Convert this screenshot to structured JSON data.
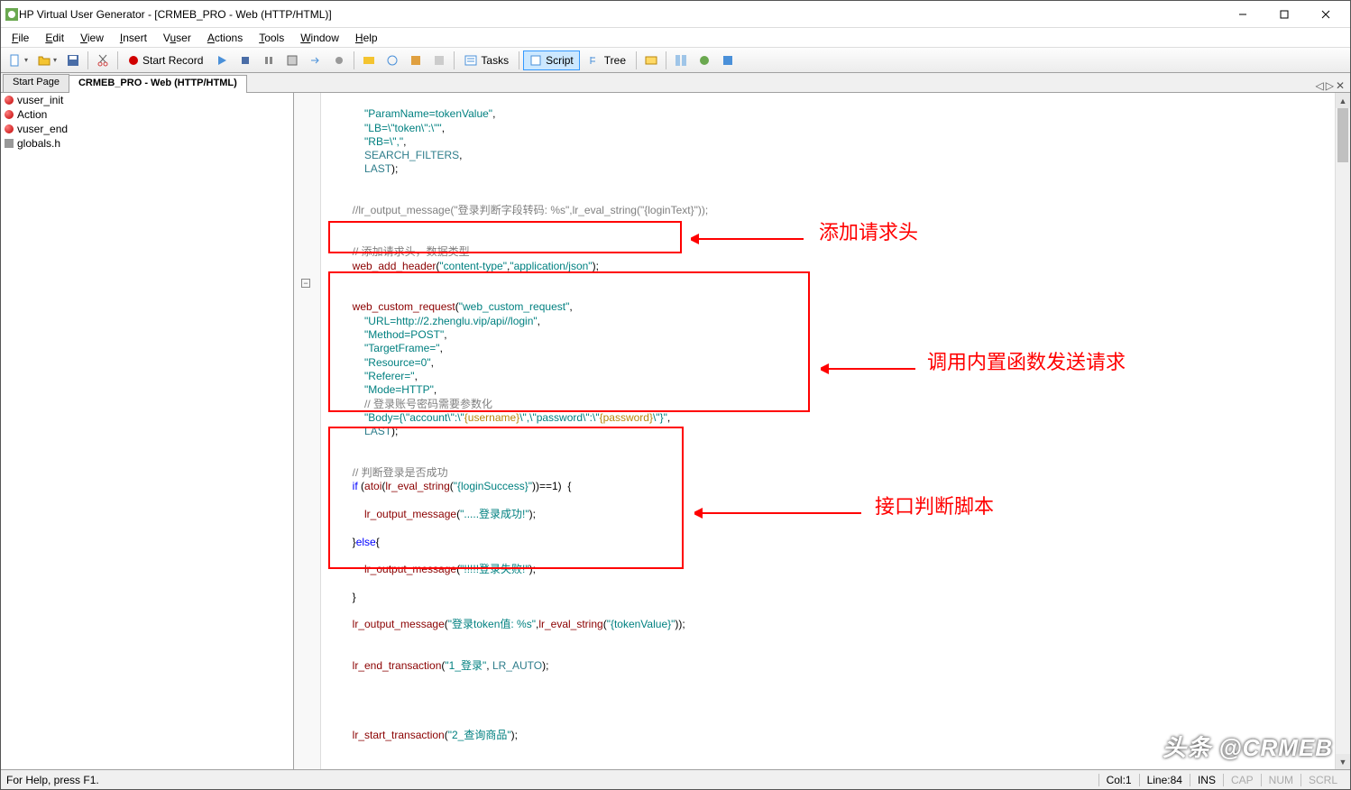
{
  "window": {
    "title": "HP Virtual User Generator - [CRMEB_PRO - Web (HTTP/HTML)]"
  },
  "menu": {
    "file": "File",
    "edit": "Edit",
    "view": "View",
    "insert": "Insert",
    "vuser": "Vuser",
    "actions": "Actions",
    "tools": "Tools",
    "window": "Window",
    "help": "Help"
  },
  "toolbar": {
    "start_record": "Start Record",
    "tasks": "Tasks",
    "script": "Script",
    "tree": "Tree"
  },
  "tabs": {
    "start_page": "Start Page",
    "active": "CRMEB_PRO - Web (HTTP/HTML)"
  },
  "tree": {
    "items": [
      "vuser_init",
      "Action",
      "vuser_end",
      "globals.h"
    ]
  },
  "code": {
    "c1": "\"ParamName=tokenValue\"",
    "c2": "\"LB=\\\"token\\\":\\\"\"",
    "c3": "\"RB=\\\",\"",
    "c4": "SEARCH_FILTERS",
    "c5": "LAST",
    "c6_cmt": "//lr_output_message(\"登录判断字段转码: %s\",lr_eval_string(\"{loginText}\"));",
    "c7_cmt": "// 添加请求头，数据类型",
    "c8_fn": "web_add_header",
    "c8_a1": "\"content-type\"",
    "c8_a2": "\"application/json\"",
    "c9_fn": "web_custom_request",
    "c9_a1": "\"web_custom_request\"",
    "c9_a2": "\"URL=http://2.zhenglu.vip/api//login\"",
    "c9_a3": "\"Method=POST\"",
    "c9_a4": "\"TargetFrame=\"",
    "c9_a5": "\"Resource=0\"",
    "c9_a6": "\"Referer=\"",
    "c9_a7": "\"Mode=HTTP\"",
    "c9_cmt": "// 登录账号密码需要参数化",
    "c9_body_pre": "\"Body={\\\"account\\\":\\\"",
    "c9_body_p1": "{username}",
    "c9_body_mid": "\\\",\\\"password\\\":\\\"",
    "c9_body_p2": "{password}",
    "c9_body_post": "\\\"}\"",
    "c10_cmt": "// 判断登录是否成功",
    "c10_atoi": "atoi",
    "c10_eval": "lr_eval_string",
    "c10_arg": "\"{loginSuccess}\"",
    "c11_fn": "lr_output_message",
    "c11_a": "\".....登录成功!\"",
    "c12_else": "else",
    "c12_a": "\"!!!!!登录失败!\"",
    "c13_fn": "lr_output_message",
    "c13_a1": "\"登录token值: %s\"",
    "c13_eval": "lr_eval_string",
    "c13_a2": "\"{tokenValue}\"",
    "c14_fn": "lr_end_transaction",
    "c14_a": "\"1_登录\"",
    "c14_auto": "LR_AUTO",
    "c15_fn": "lr_start_transaction",
    "c15_a": "\"2_查询商品\"",
    "kw_if": "if"
  },
  "annotations": {
    "a1": "添加请求头",
    "a2": "调用内置函数发送请求",
    "a3": "接口判断脚本"
  },
  "status": {
    "help": "For Help, press F1.",
    "col": "Col:1",
    "line": "Line:84",
    "ins": "INS",
    "cap": "CAP",
    "num": "NUM",
    "scrl": "SCRL"
  },
  "watermark": "头条 @CRMEB"
}
